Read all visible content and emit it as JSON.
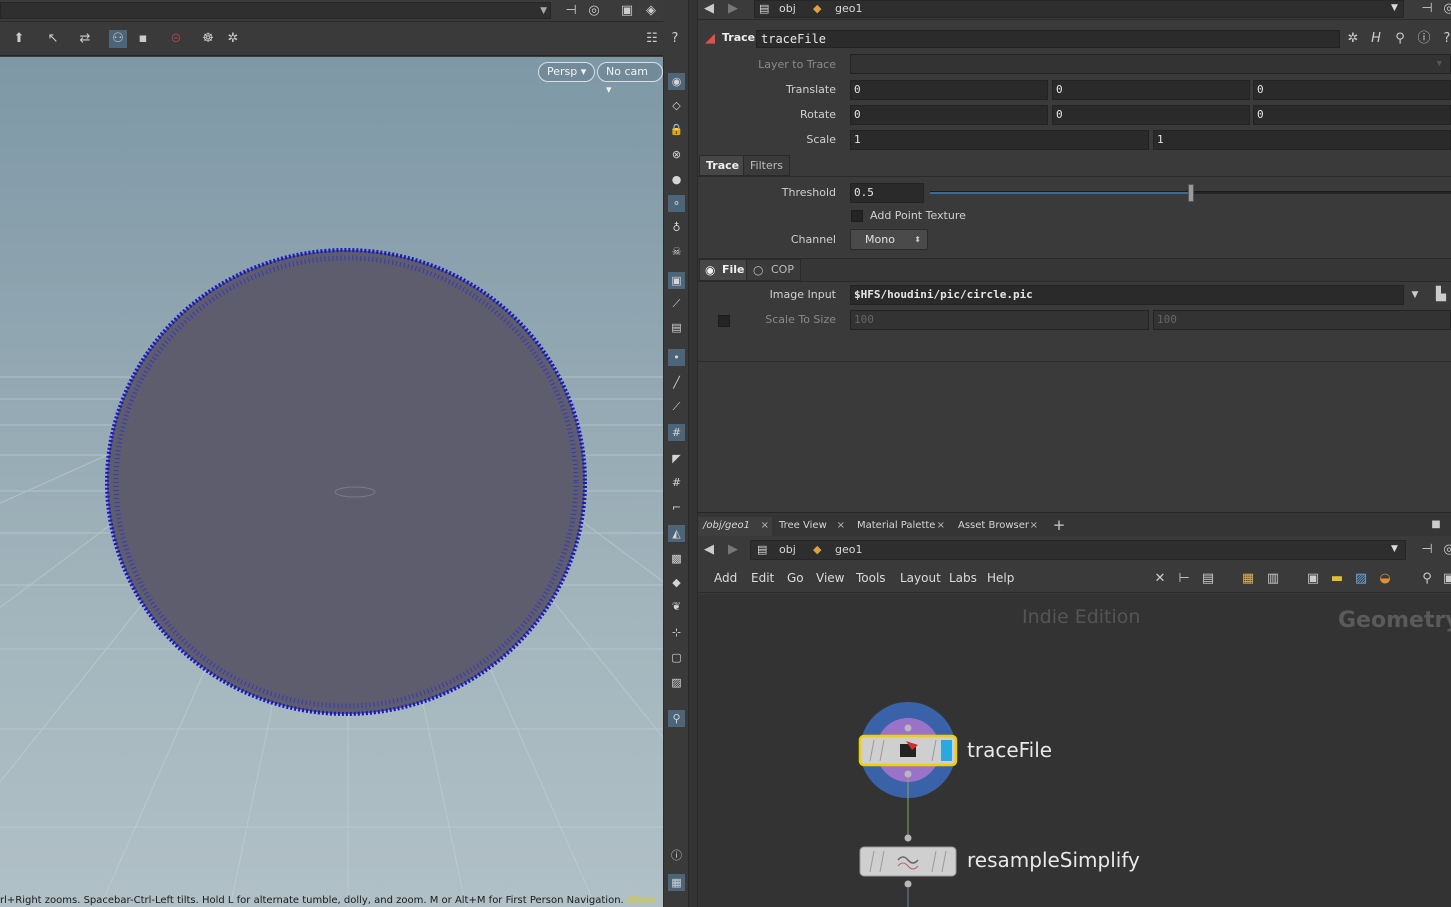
{
  "viewport": {
    "persp_label": "Persp",
    "cam_label": "No cam",
    "status_text": "rl+Right zooms. Spacebar-Ctrl-Left tilts. Hold L for alternate tumble, dolly, and zoom.    M or Alt+M for First Person Navigation.",
    "status_highlight": "dition"
  },
  "param_pane": {
    "path": [
      "obj",
      "geo1"
    ],
    "node_type": "Trace",
    "node_name": "traceFile",
    "layer_to_trace_label": "Layer to Trace",
    "translate": {
      "label": "Translate",
      "values": [
        "0",
        "0",
        "0"
      ]
    },
    "rotate": {
      "label": "Rotate",
      "values": [
        "0",
        "0",
        "0"
      ]
    },
    "scale": {
      "label": "Scale",
      "values": [
        "1",
        "1"
      ]
    },
    "tabs": [
      "Trace",
      "Filters"
    ],
    "threshold": {
      "label": "Threshold",
      "value": "0.5",
      "slider_fraction": 0.5
    },
    "add_point_texture_label": "Add Point Texture",
    "channel": {
      "label": "Channel",
      "value": "Mono"
    },
    "source_options": [
      "File",
      "COP"
    ],
    "image_input": {
      "label": "Image Input",
      "value": "$HFS/houdini/pic/circle.pic"
    },
    "scale_to_size": {
      "label": "Scale To Size",
      "values": [
        "100",
        "100"
      ]
    }
  },
  "network": {
    "tabs": [
      "/obj/geo1",
      "Tree View",
      "Material Palette",
      "Asset Browser"
    ],
    "path": [
      "obj",
      "geo1"
    ],
    "menu": [
      "Add",
      "Edit",
      "Go",
      "View",
      "Tools",
      "Layout",
      "Labs",
      "Help"
    ],
    "watermark": "Indie Edition",
    "context_label": "Geometry",
    "nodes": [
      {
        "name": "traceFile"
      },
      {
        "name": "resampleSimplify"
      }
    ]
  },
  "colors": {
    "accent": "#4d6578",
    "node_selected": "#f0d000",
    "display_flag": "#2aa8e0",
    "point_blue": "#1a1ad0"
  }
}
